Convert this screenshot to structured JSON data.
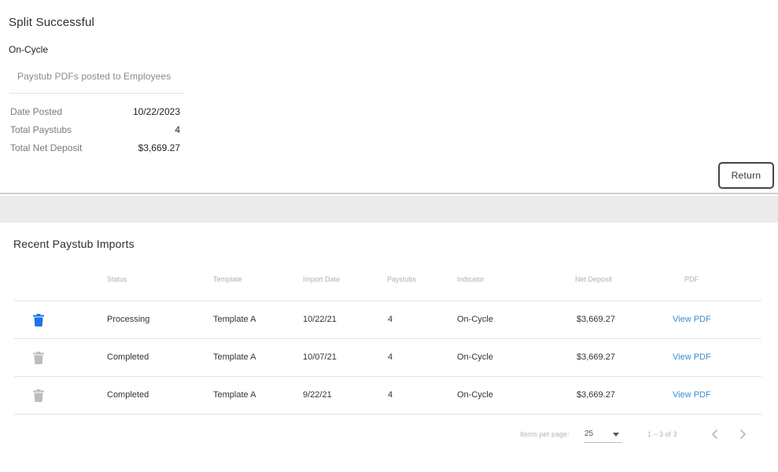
{
  "summary": {
    "title": "Split Successful",
    "indicator": "On-Cycle",
    "note": "Paystub PDFs posted to Employees",
    "rows": [
      {
        "label": "Date Posted",
        "value": "10/22/2023"
      },
      {
        "label": "Total Paystubs",
        "value": "4"
      },
      {
        "label": "Total Net Deposit",
        "value": "$3,669.27"
      }
    ],
    "return_label": "Return"
  },
  "imports": {
    "title": "Recent Paystub Imports",
    "columns": [
      "Status",
      "Template",
      "Import Date",
      "Paystubs",
      "Indicator",
      "Net Deposit",
      "PDF"
    ],
    "rows": [
      {
        "status": "Processing",
        "template": "Template A",
        "date": "10/22/21",
        "paystubs": "4",
        "indicator": "On-Cycle",
        "net": "$3,669.27",
        "pdf": "View PDF",
        "icon": "trash-icon",
        "icon_color": "#1a73e8"
      },
      {
        "status": "Completed",
        "template": "Template A",
        "date": "10/07/21",
        "paystubs": "4",
        "indicator": "On-Cycle",
        "net": "$3,669.27",
        "pdf": "View PDF",
        "icon": "trash-icon",
        "icon_color": "#bdbdbd"
      },
      {
        "status": "Completed",
        "template": "Template A",
        "date": "9/22/21",
        "paystubs": "4",
        "indicator": "On-Cycle",
        "net": "$3,669.27",
        "pdf": "View PDF",
        "icon": "trash-icon",
        "icon_color": "#bdbdbd"
      }
    ]
  },
  "pager": {
    "items_per_page_label": "Items per page:",
    "items_per_page": "25",
    "range": "1 – 3 of 3",
    "prev_icon": "chevron-left-icon",
    "next_icon": "chevron-right-icon"
  },
  "colors": {
    "link": "#3d8bd9",
    "accent": "#1a73e8"
  }
}
